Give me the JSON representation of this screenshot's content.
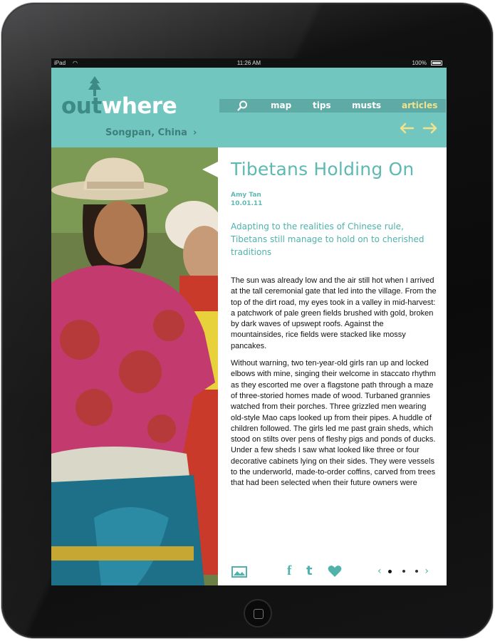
{
  "status_bar": {
    "carrier": "iPad",
    "time": "11:26 AM",
    "battery": "100%"
  },
  "header": {
    "logo_out": "out",
    "logo_where": "where",
    "location": "Songpan, China",
    "nav": {
      "map": "map",
      "tips": "tips",
      "musts": "musts",
      "articles": "articles"
    }
  },
  "article": {
    "title": "Tibetans Holding On",
    "author": "Amy Tan",
    "date": "10.01.11",
    "deck": "Adapting to the realities of Chinese rule, Tibetans still manage to hold on to cherished traditions",
    "paragraphs": [
      "The sun was already low and the air still hot when I arrived at the tall ceremonial gate that led into the village. From the top of the dirt road, my eyes took in a valley in mid-harvest: a patchwork of pale green fields brushed with gold, broken by dark waves of upswept roofs. Against the mountainsides, rice fields were stacked like mossy pancakes.",
      "Without warning, two ten-year-old girls ran up and locked elbows with mine, singing their welcome in staccato rhythm as they escorted me over a flagstone path through a maze of three-storied homes made of wood. Turbaned grannies watched from their porches. Three grizzled men wearing old-style Mao caps looked up from their pipes. A huddle of children followed. The girls led me past grain sheds, which stood on stilts over pens of fleshy pigs and ponds of ducks. Under a few sheds I saw what looked like three or four decorative cabinets lying on their sides. They were vessels to the underworld, made-to-order coffins, carved from trees that had been selected when their future owners were"
    ]
  },
  "toolbar": {
    "facebook": "f",
    "twitter": "t",
    "prev": "‹",
    "next": "›"
  },
  "colors": {
    "teal": "#72c6c0",
    "accent_text": "#4fb2ab",
    "articles_highlight": "#f2e28a"
  }
}
